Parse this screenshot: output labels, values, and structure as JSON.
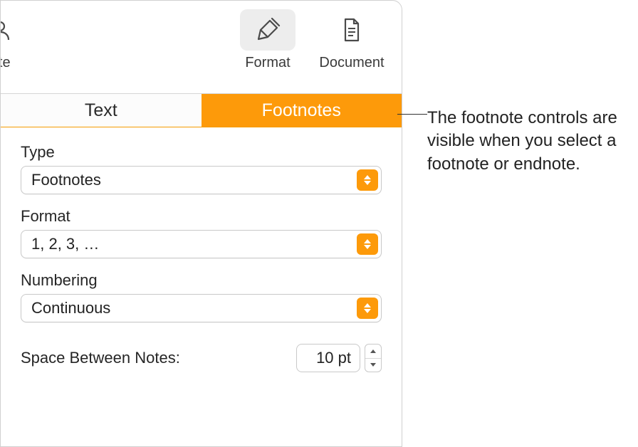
{
  "toolbar": {
    "left_partial_label": "orate",
    "format_label": "Format",
    "document_label": "Document"
  },
  "tabs": {
    "text": "Text",
    "footnotes": "Footnotes"
  },
  "fields": {
    "type": {
      "label": "Type",
      "value": "Footnotes"
    },
    "format": {
      "label": "Format",
      "value": "1, 2, 3, …"
    },
    "numbering": {
      "label": "Numbering",
      "value": "Continuous"
    }
  },
  "space": {
    "label": "Space Between Notes:",
    "value": "10 pt"
  },
  "callout": "The footnote controls are visible when you select a footnote or endnote."
}
